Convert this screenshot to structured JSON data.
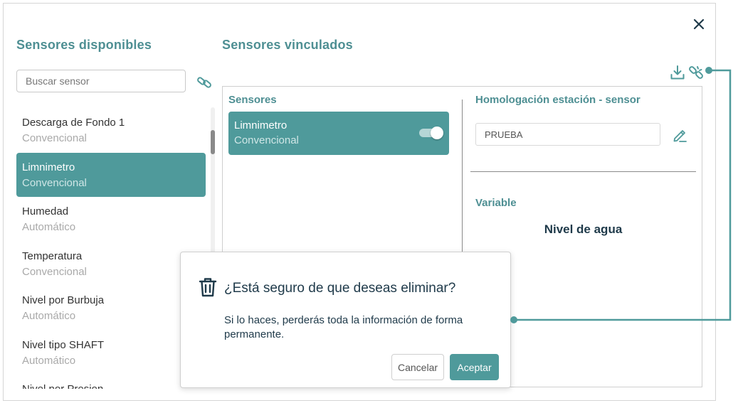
{
  "dialog_window": {
    "available_title": "Sensores disponibles",
    "linked_title": "Sensores vinculados",
    "search_placeholder": "Buscar sensor"
  },
  "available_sensors": [
    {
      "name": "Descarga de Fondo 1",
      "type": "Convencional",
      "selected": false
    },
    {
      "name": "Limnimetro",
      "type": "Convencional",
      "selected": true
    },
    {
      "name": "Humedad",
      "type": "Automático",
      "selected": false
    },
    {
      "name": "Temperatura",
      "type": "Convencional",
      "selected": false
    },
    {
      "name": "Nivel por Burbuja",
      "type": "Automático",
      "selected": false
    },
    {
      "name": "Nivel tipo SHAFT",
      "type": "Automático",
      "selected": false
    },
    {
      "name": "Nivel por Presion",
      "type": "",
      "selected": false
    }
  ],
  "linked_panel": {
    "sensors_title": "Sensores",
    "linked_sensor": {
      "name": "Limnimetro",
      "type": "Convencional",
      "enabled": true
    },
    "homologation_title": "Homologación estación - sensor",
    "homologation_value": "PRUEBA",
    "variable_title": "Variable",
    "variable_value": "Nivel de agua"
  },
  "confirm_dialog": {
    "title": "¿Está seguro de que deseas eliminar?",
    "message": "Si lo haces, perderás toda la información de forma permanente.",
    "cancel_label": "Cancelar",
    "accept_label": "Aceptar"
  },
  "icons": {
    "close": "close-icon",
    "link": "link-icon",
    "download": "download-icon",
    "unlink": "unlink-icon",
    "edit": "pencil-icon",
    "trash": "trash-icon"
  },
  "colors": {
    "accent": "#4f9a9b",
    "title": "#4e8f93",
    "dark_text": "#1f3a4a",
    "muted_text": "#a9a9a9"
  }
}
